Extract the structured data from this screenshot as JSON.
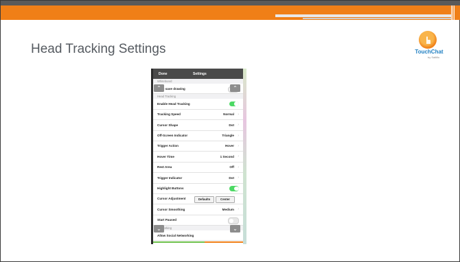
{
  "slide": {
    "title": "Head Tracking Settings",
    "logo_brand": "TouchChat",
    "logo_sub": "by Saltillo",
    "accent_color": "#f07f17"
  },
  "phone": {
    "nav": {
      "done": "Done",
      "title": "Settings"
    },
    "sections": {
      "whiteboard": "Whiteboard",
      "head_tracking": "Head Tracking",
      "networking": "Networking"
    },
    "rows": {
      "save_drawing": {
        "label": "Auto save drawing",
        "toggle": "off"
      },
      "enable_head_tracking": {
        "label": "Enable Head Tracking",
        "toggle": "on"
      },
      "tracking_speed": {
        "label": "Tracking Speed",
        "value": "Normal"
      },
      "cursor_shape": {
        "label": "Cursor Shape",
        "value": "Dot"
      },
      "offscreen_indicator": {
        "label": "Off-Screen Indicator",
        "value": "Triangle"
      },
      "trigger_action": {
        "label": "Trigger Action",
        "value": "Hover"
      },
      "hover_time": {
        "label": "Hover Time",
        "value": "1 Second"
      },
      "rest_area": {
        "label": "Rest Area",
        "value": "Off"
      },
      "trigger_indicator": {
        "label": "Trigger Indicator",
        "value": "Dot"
      },
      "highlight_buttons": {
        "label": "Highlight Buttons",
        "toggle": "on"
      },
      "cursor_adjustment": {
        "label": "Cursor Adjustment",
        "defaults": "Defaults",
        "center": "Center"
      },
      "cursor_smoothing": {
        "label": "Cursor Smoothing",
        "value": "Medium"
      },
      "start_paused": {
        "label": "Start Paused",
        "toggle": "off"
      },
      "allow_social": {
        "label": "Allow Social Networking"
      }
    },
    "chevron": "›",
    "arrow_up": "⌃",
    "arrow_down": "⌄"
  }
}
